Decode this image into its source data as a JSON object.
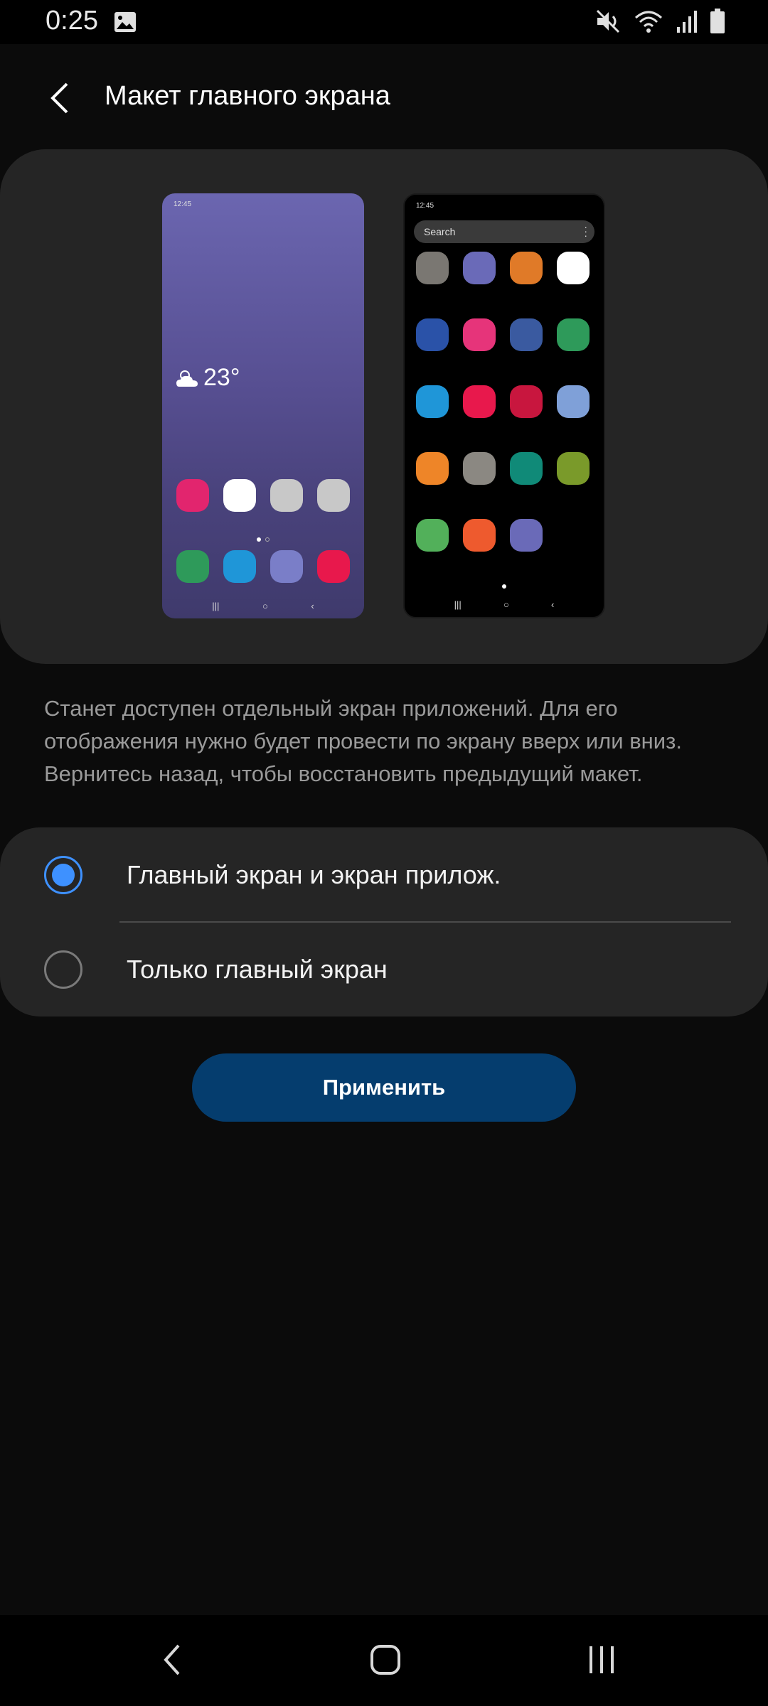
{
  "status_bar": {
    "time": "0:25",
    "icons": [
      "gallery-icon",
      "mute-icon",
      "wifi-icon",
      "signal-icon",
      "battery-icon"
    ]
  },
  "header": {
    "title": "Макет главного экрана",
    "back_icon": "chevron-left-icon"
  },
  "preview": {
    "home_phone": {
      "time": "12:45",
      "weather_temp": "23°",
      "weather_icon": "partly-cloudy-icon",
      "row1_colors": [
        "#e2256e",
        "#ffffff",
        "#c8c8c8",
        "#c8c8c8"
      ],
      "row2_colors": [
        "#2e9a5a",
        "#1f96d8",
        "#7a7ec8",
        "#e8184c"
      ]
    },
    "apps_phone": {
      "time": "12:45",
      "search_placeholder": "Search",
      "grid_colors": [
        "#7a7772",
        "#6a6ab8",
        "#e07a28",
        "#ffffff",
        "#2a52a8",
        "#e6347a",
        "#3a5aa0",
        "#2e9a5a",
        "#1f96d8",
        "#e8184c",
        "#c8163e",
        "#7fa0d8",
        "#ee8528",
        "#8b8882",
        "#108a78",
        "#7a9a2a",
        "#52b05a",
        "#ee5a2e",
        "#6a6ab8"
      ]
    }
  },
  "description": "Станет доступен отдельный экран приложений. Для его отображения нужно будет провести по экрану вверх или вниз. Вернитесь назад, чтобы восстановить предыдущий макет.",
  "options": [
    {
      "label": "Главный экран и экран прилож.",
      "selected": true
    },
    {
      "label": "Только главный экран",
      "selected": false
    }
  ],
  "apply_label": "Применить",
  "nav_bar": {
    "icons": [
      "back-icon",
      "home-icon",
      "recents-icon"
    ]
  },
  "colors": {
    "accent": "#3e91ff",
    "button_bg": "#053d6e",
    "card_bg": "#252525",
    "background": "#0b0b0b"
  }
}
